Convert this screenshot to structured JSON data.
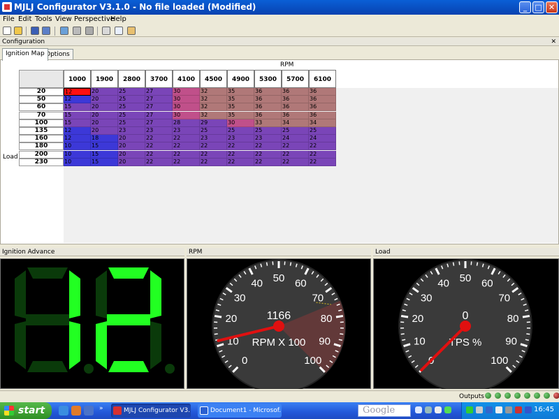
{
  "window": {
    "title": "MJLJ Configurator V3.1.0 - No file loaded (Modified)",
    "minimize": "_",
    "maximize": "□",
    "close": "✕"
  },
  "menu": [
    "File",
    "Edit",
    "Tools",
    "View",
    "Perspective",
    "Help"
  ],
  "toolbar_icons": [
    "new-file-icon",
    "open-folder-icon",
    "save-icon",
    "save-all-icon",
    "upload-icon",
    "download-icon",
    "refresh-icon",
    "settings-icon",
    "chart-icon",
    "wrench-icon"
  ],
  "configuration": {
    "header": "Configuration",
    "close": "✕",
    "tabs": [
      "Ignition Map",
      "Options"
    ],
    "rpm_label": "RPM",
    "load_label": "Load",
    "rpm_columns": [
      "1000",
      "1900",
      "2800",
      "3700",
      "4100",
      "4500",
      "4900",
      "5300",
      "5700",
      "6100"
    ],
    "load_rows": [
      "20",
      "50",
      "60",
      "70",
      "100",
      "135",
      "160",
      "180",
      "200",
      "230"
    ],
    "values": [
      [
        12,
        20,
        25,
        27,
        30,
        32,
        35,
        36,
        36,
        36
      ],
      [
        12,
        20,
        25,
        27,
        30,
        32,
        35,
        36,
        36,
        36
      ],
      [
        15,
        20,
        25,
        27,
        30,
        32,
        35,
        36,
        36,
        36
      ],
      [
        15,
        20,
        25,
        27,
        30,
        32,
        35,
        36,
        36,
        36
      ],
      [
        15,
        20,
        25,
        27,
        28,
        29,
        30,
        33,
        34,
        34
      ],
      [
        12,
        20,
        23,
        23,
        23,
        25,
        25,
        25,
        25,
        25
      ],
      [
        12,
        18,
        20,
        22,
        22,
        23,
        23,
        23,
        24,
        24
      ],
      [
        10,
        15,
        20,
        22,
        22,
        22,
        22,
        22,
        22,
        22
      ],
      [
        10,
        15,
        20,
        22,
        22,
        22,
        22,
        22,
        22,
        22
      ],
      [
        10,
        15,
        20,
        22,
        22,
        22,
        22,
        22,
        22,
        22
      ]
    ],
    "selected_cell": [
      0,
      0
    ]
  },
  "panels": {
    "ignition": {
      "title": "Ignition Advance",
      "value": "12"
    },
    "rpm": {
      "title": "RPM",
      "value": "1166",
      "unit_label": "RPM X 100",
      "scale_labels": [
        "0",
        "10",
        "20",
        "30",
        "40",
        "50",
        "60",
        "70",
        "80",
        "90",
        "100"
      ],
      "needle_value": 11.66
    },
    "load": {
      "title": "Load",
      "value": "0",
      "unit_label": "TPS %",
      "scale_labels": [
        "0",
        "10",
        "20",
        "30",
        "40",
        "50",
        "60",
        "70",
        "80",
        "90",
        "100"
      ],
      "needle_value": 0
    }
  },
  "status": {
    "outputs_label": "Outputs",
    "leds": [
      "green",
      "green",
      "green",
      "green",
      "green",
      "green",
      "green",
      "red"
    ]
  },
  "taskbar": {
    "start": "start",
    "tasks": [
      {
        "label": "MJLJ Configurator V3...",
        "icon": "java-icon",
        "active": true
      },
      {
        "label": "Document1 - Microsof...",
        "icon": "word-icon",
        "active": false
      }
    ],
    "search_placeholder": "Google",
    "time": "16:45"
  },
  "colors": {
    "hi": "#b07878",
    "mid": "#7a45b8",
    "low": "#3c38d8",
    "pink": "#c0508a",
    "selected": "#ff1010",
    "digit": "#22ff22",
    "digit_dim": "#0a3a0a"
  }
}
